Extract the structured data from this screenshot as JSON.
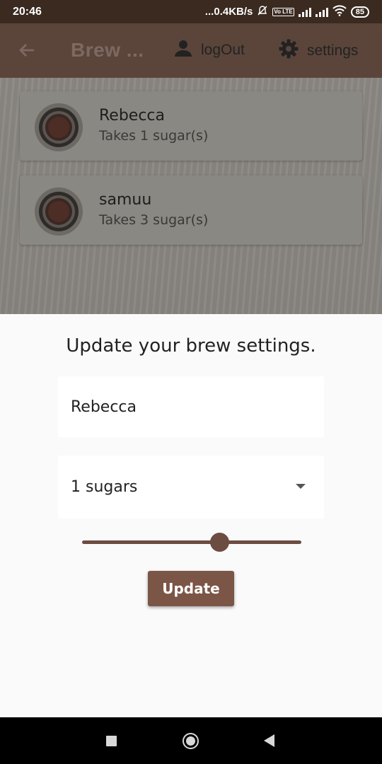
{
  "status_bar": {
    "time": "20:46",
    "network_speed": "...0.4KB/s",
    "volte_label": "Vo LTE",
    "battery": "85"
  },
  "app_bar": {
    "title": "Brew ...",
    "logout_label": "logOut",
    "settings_label": "settings",
    "background_color": "#5b453b"
  },
  "brews": [
    {
      "name": "Rebecca",
      "subtitle": "Takes 1 sugar(s)"
    },
    {
      "name": "samuu",
      "subtitle": "Takes 3 sugar(s)"
    }
  ],
  "sheet": {
    "title": "Update your brew settings.",
    "name_value": "Rebecca",
    "sugars_value": "1 sugars",
    "strength_fraction": 0.625,
    "update_label": "Update",
    "accent_color": "#7b5546"
  },
  "icons": {
    "back": "arrow-left",
    "logout": "person",
    "settings": "gear",
    "avatar": "coffee-cup"
  }
}
